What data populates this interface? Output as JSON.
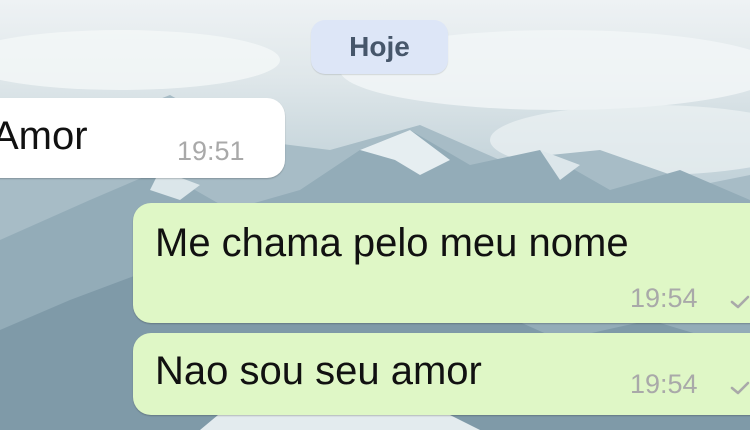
{
  "chat": {
    "date_separator": "Hoje",
    "messages": [
      {
        "direction": "incoming",
        "text": "Amor",
        "time": "19:51"
      },
      {
        "direction": "outgoing",
        "text": "Me chama pelo meu nome",
        "time": "19:54",
        "status_icon": "check-icon"
      },
      {
        "direction": "outgoing",
        "text": "Nao sou seu amor",
        "time": "19:54",
        "status_icon": "check-icon"
      }
    ]
  },
  "colors": {
    "incoming_bubble": "#ffffff",
    "outgoing_bubble": "#dff7c6",
    "date_pill": "#dde6f7",
    "timestamp": "#a9a9a9",
    "check_icon": "#a9a9a9"
  }
}
